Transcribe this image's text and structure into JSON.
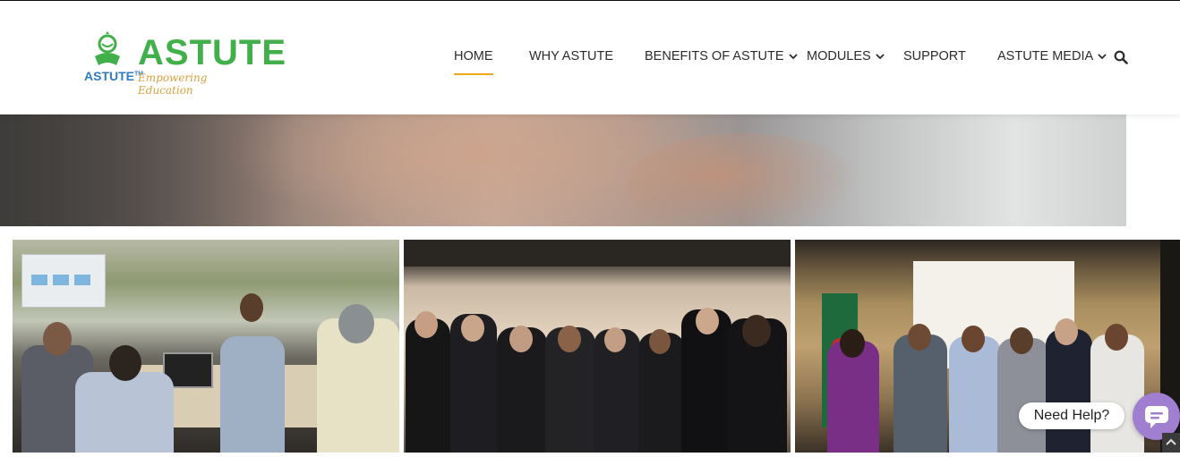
{
  "logo": {
    "icon_name": "astute-logo-icon",
    "small_text": "ASTUTE",
    "trademark": "TM",
    "brand": "ASTUTE",
    "tagline": "Empowering Education"
  },
  "nav": {
    "items": [
      {
        "label": "HOME",
        "active": true,
        "has_dropdown": false
      },
      {
        "label": "WHY ASTUTE",
        "active": false,
        "has_dropdown": false
      },
      {
        "label": "BENEFITS OF ASTUTE",
        "active": false,
        "has_dropdown": true
      },
      {
        "label": "MODULES",
        "active": false,
        "has_dropdown": true
      },
      {
        "label": "SUPPORT",
        "active": false,
        "has_dropdown": false
      },
      {
        "label": "ASTUTE MEDIA",
        "active": false,
        "has_dropdown": true
      }
    ],
    "search_icon": "search-icon",
    "accent_color": "#f0a818"
  },
  "gallery": {
    "photos": [
      {
        "name": "meeting-photo"
      },
      {
        "name": "group-photo-japan"
      },
      {
        "name": "group-photo-bangladesh"
      }
    ]
  },
  "chat": {
    "label": "Need Help?",
    "icon": "chat-icon",
    "color": "#a07fd0"
  },
  "colors": {
    "brand_green": "#41b04a",
    "brand_blue": "#2f7dbf",
    "tagline_gold": "#d9a03c"
  }
}
